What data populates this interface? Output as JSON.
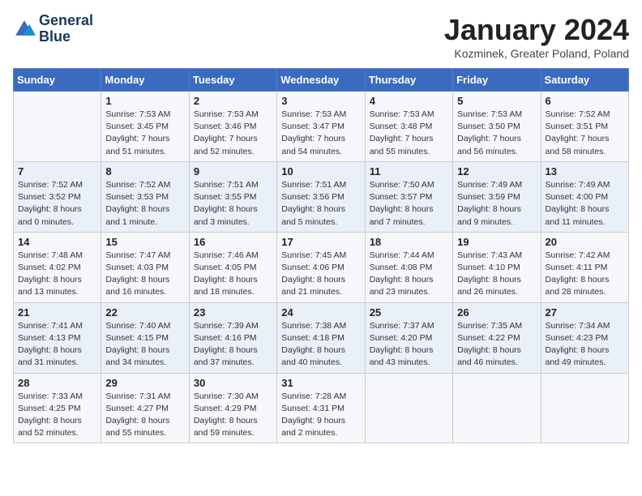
{
  "header": {
    "logo_line1": "General",
    "logo_line2": "Blue",
    "title": "January 2024",
    "subtitle": "Kozminek, Greater Poland, Poland"
  },
  "days_of_week": [
    "Sunday",
    "Monday",
    "Tuesday",
    "Wednesday",
    "Thursday",
    "Friday",
    "Saturday"
  ],
  "weeks": [
    [
      {
        "day": "",
        "info": ""
      },
      {
        "day": "1",
        "info": "Sunrise: 7:53 AM\nSunset: 3:45 PM\nDaylight: 7 hours\nand 51 minutes."
      },
      {
        "day": "2",
        "info": "Sunrise: 7:53 AM\nSunset: 3:46 PM\nDaylight: 7 hours\nand 52 minutes."
      },
      {
        "day": "3",
        "info": "Sunrise: 7:53 AM\nSunset: 3:47 PM\nDaylight: 7 hours\nand 54 minutes."
      },
      {
        "day": "4",
        "info": "Sunrise: 7:53 AM\nSunset: 3:48 PM\nDaylight: 7 hours\nand 55 minutes."
      },
      {
        "day": "5",
        "info": "Sunrise: 7:53 AM\nSunset: 3:50 PM\nDaylight: 7 hours\nand 56 minutes."
      },
      {
        "day": "6",
        "info": "Sunrise: 7:52 AM\nSunset: 3:51 PM\nDaylight: 7 hours\nand 58 minutes."
      }
    ],
    [
      {
        "day": "7",
        "info": "Sunrise: 7:52 AM\nSunset: 3:52 PM\nDaylight: 8 hours\nand 0 minutes."
      },
      {
        "day": "8",
        "info": "Sunrise: 7:52 AM\nSunset: 3:53 PM\nDaylight: 8 hours\nand 1 minute."
      },
      {
        "day": "9",
        "info": "Sunrise: 7:51 AM\nSunset: 3:55 PM\nDaylight: 8 hours\nand 3 minutes."
      },
      {
        "day": "10",
        "info": "Sunrise: 7:51 AM\nSunset: 3:56 PM\nDaylight: 8 hours\nand 5 minutes."
      },
      {
        "day": "11",
        "info": "Sunrise: 7:50 AM\nSunset: 3:57 PM\nDaylight: 8 hours\nand 7 minutes."
      },
      {
        "day": "12",
        "info": "Sunrise: 7:49 AM\nSunset: 3:59 PM\nDaylight: 8 hours\nand 9 minutes."
      },
      {
        "day": "13",
        "info": "Sunrise: 7:49 AM\nSunset: 4:00 PM\nDaylight: 8 hours\nand 11 minutes."
      }
    ],
    [
      {
        "day": "14",
        "info": "Sunrise: 7:48 AM\nSunset: 4:02 PM\nDaylight: 8 hours\nand 13 minutes."
      },
      {
        "day": "15",
        "info": "Sunrise: 7:47 AM\nSunset: 4:03 PM\nDaylight: 8 hours\nand 16 minutes."
      },
      {
        "day": "16",
        "info": "Sunrise: 7:46 AM\nSunset: 4:05 PM\nDaylight: 8 hours\nand 18 minutes."
      },
      {
        "day": "17",
        "info": "Sunrise: 7:45 AM\nSunset: 4:06 PM\nDaylight: 8 hours\nand 21 minutes."
      },
      {
        "day": "18",
        "info": "Sunrise: 7:44 AM\nSunset: 4:08 PM\nDaylight: 8 hours\nand 23 minutes."
      },
      {
        "day": "19",
        "info": "Sunrise: 7:43 AM\nSunset: 4:10 PM\nDaylight: 8 hours\nand 26 minutes."
      },
      {
        "day": "20",
        "info": "Sunrise: 7:42 AM\nSunset: 4:11 PM\nDaylight: 8 hours\nand 28 minutes."
      }
    ],
    [
      {
        "day": "21",
        "info": "Sunrise: 7:41 AM\nSunset: 4:13 PM\nDaylight: 8 hours\nand 31 minutes."
      },
      {
        "day": "22",
        "info": "Sunrise: 7:40 AM\nSunset: 4:15 PM\nDaylight: 8 hours\nand 34 minutes."
      },
      {
        "day": "23",
        "info": "Sunrise: 7:39 AM\nSunset: 4:16 PM\nDaylight: 8 hours\nand 37 minutes."
      },
      {
        "day": "24",
        "info": "Sunrise: 7:38 AM\nSunset: 4:18 PM\nDaylight: 8 hours\nand 40 minutes."
      },
      {
        "day": "25",
        "info": "Sunrise: 7:37 AM\nSunset: 4:20 PM\nDaylight: 8 hours\nand 43 minutes."
      },
      {
        "day": "26",
        "info": "Sunrise: 7:35 AM\nSunset: 4:22 PM\nDaylight: 8 hours\nand 46 minutes."
      },
      {
        "day": "27",
        "info": "Sunrise: 7:34 AM\nSunset: 4:23 PM\nDaylight: 8 hours\nand 49 minutes."
      }
    ],
    [
      {
        "day": "28",
        "info": "Sunrise: 7:33 AM\nSunset: 4:25 PM\nDaylight: 8 hours\nand 52 minutes."
      },
      {
        "day": "29",
        "info": "Sunrise: 7:31 AM\nSunset: 4:27 PM\nDaylight: 8 hours\nand 55 minutes."
      },
      {
        "day": "30",
        "info": "Sunrise: 7:30 AM\nSunset: 4:29 PM\nDaylight: 8 hours\nand 59 minutes."
      },
      {
        "day": "31",
        "info": "Sunrise: 7:28 AM\nSunset: 4:31 PM\nDaylight: 9 hours\nand 2 minutes."
      },
      {
        "day": "",
        "info": ""
      },
      {
        "day": "",
        "info": ""
      },
      {
        "day": "",
        "info": ""
      }
    ]
  ]
}
